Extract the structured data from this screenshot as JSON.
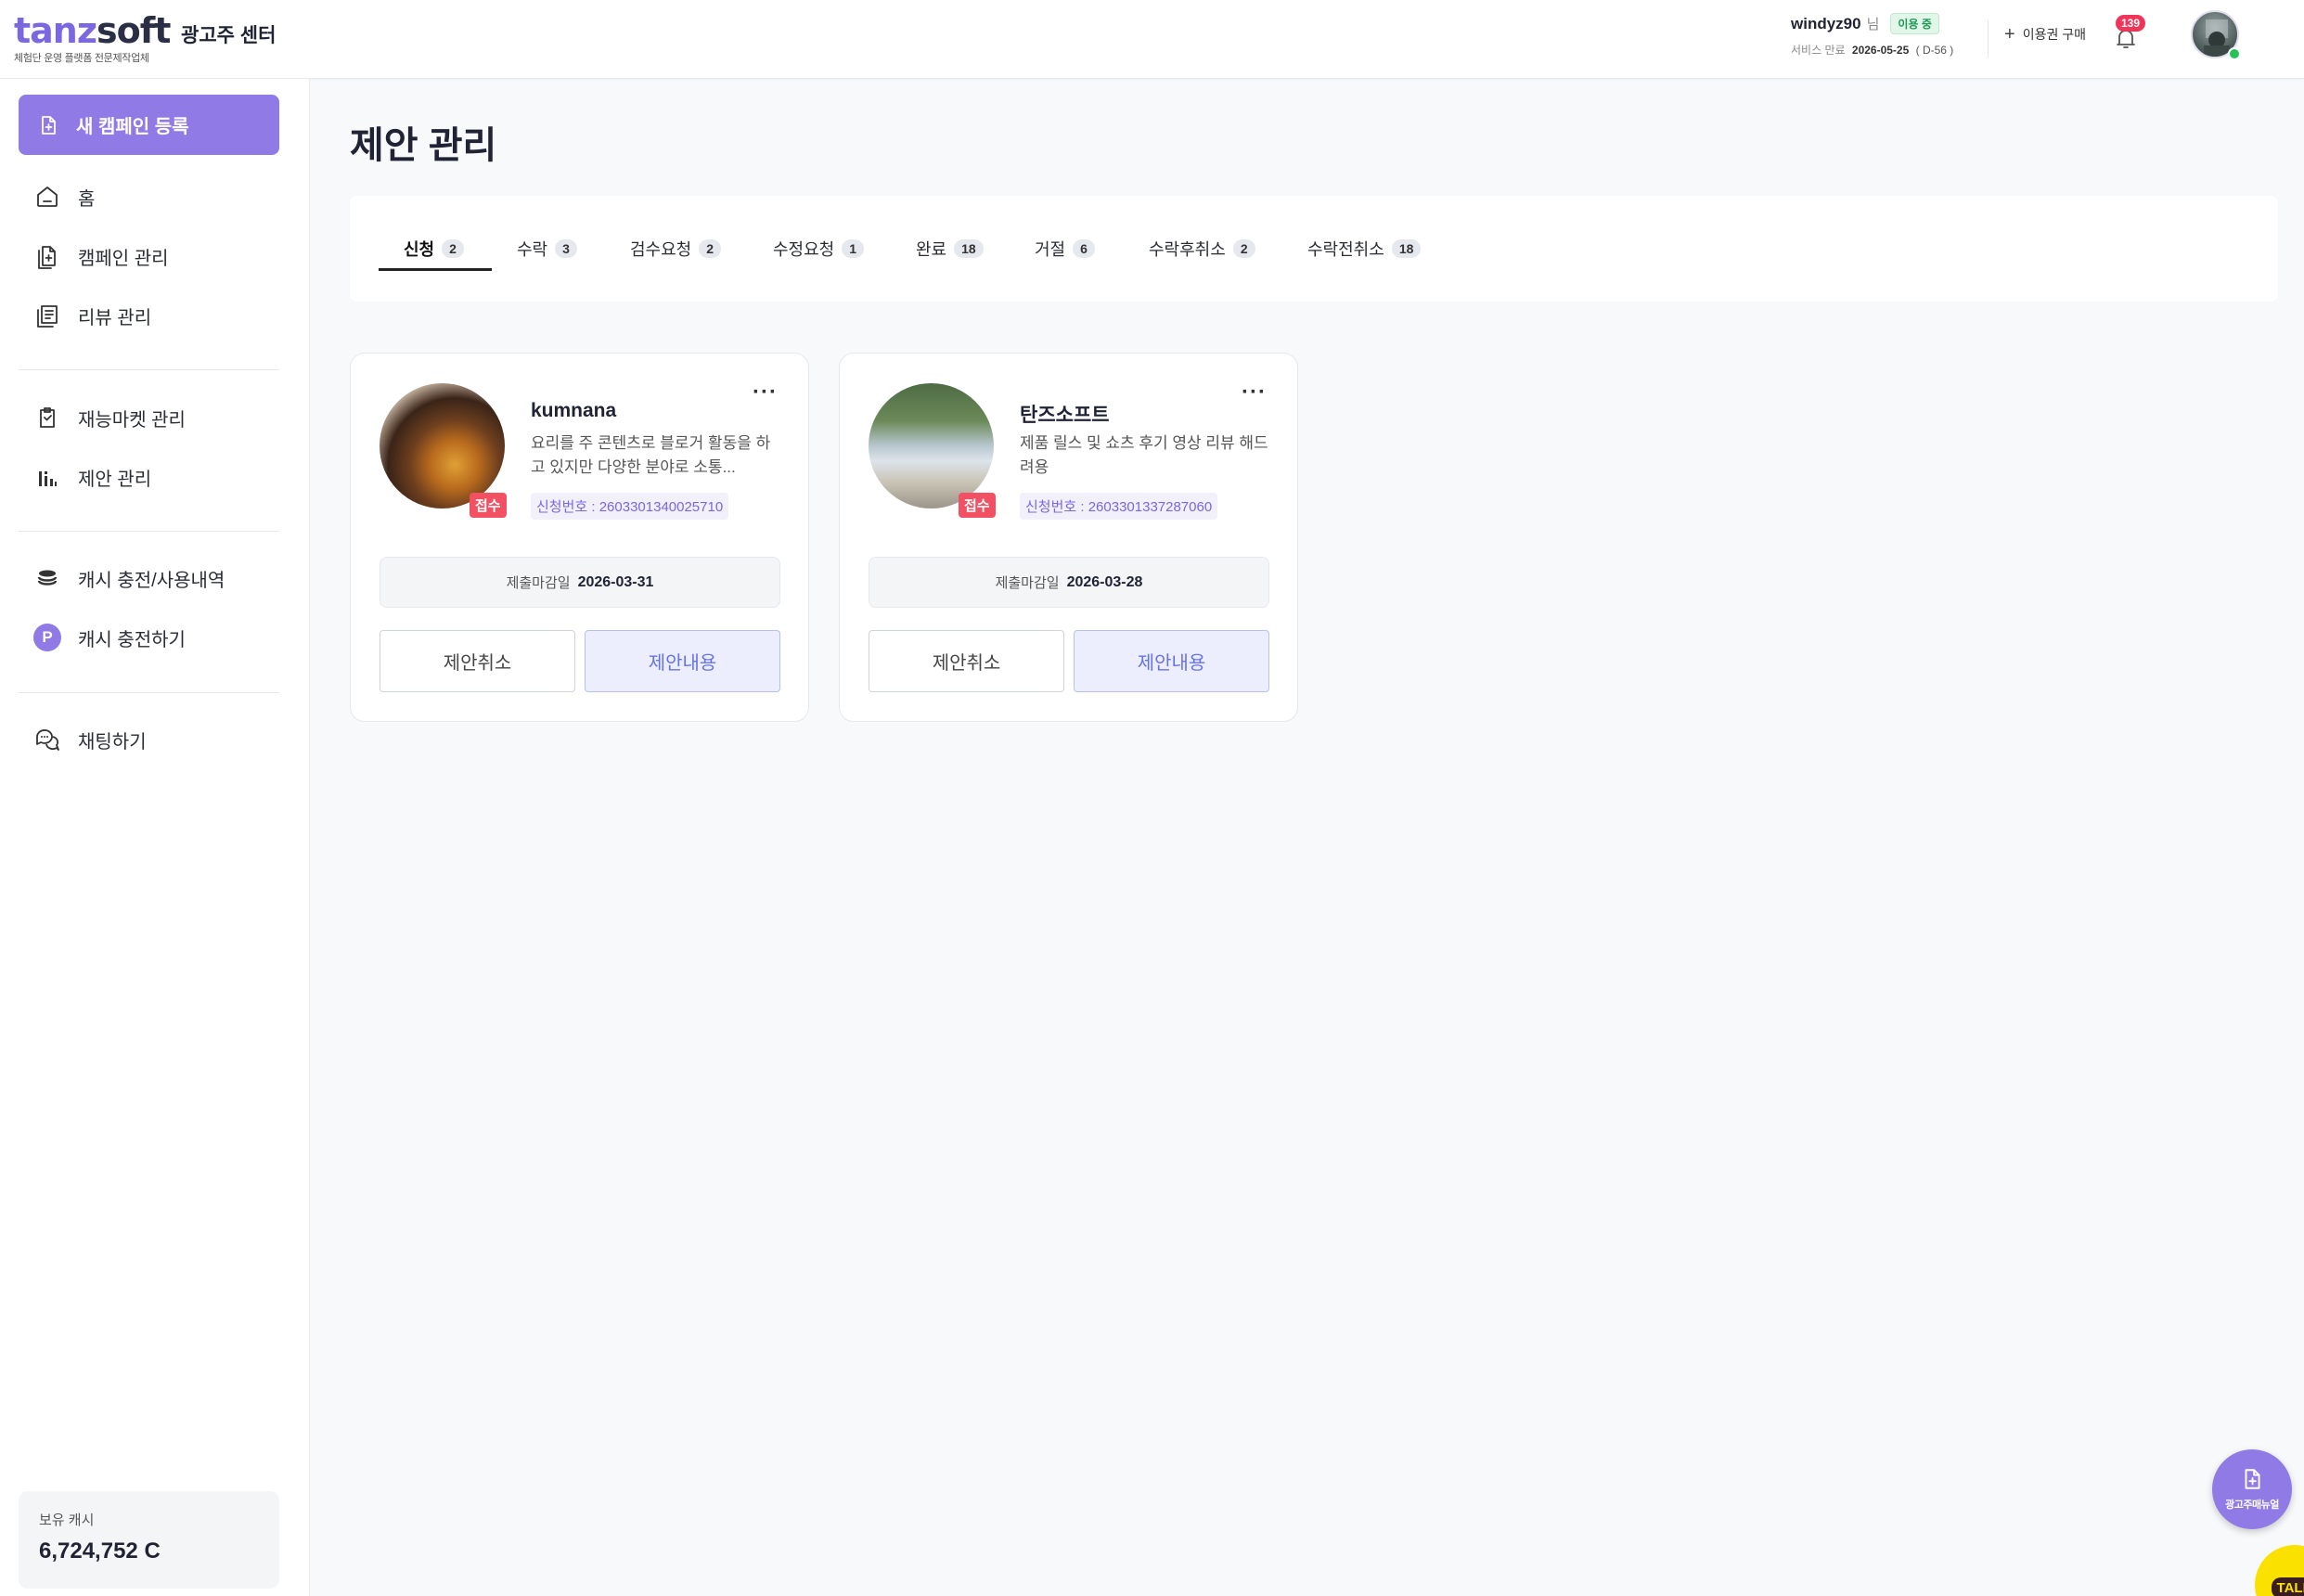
{
  "header": {
    "logo_part1": "tanz",
    "logo_part2": "soft",
    "logo_tagline": "체험단 운영 플랫폼 전문제작업체",
    "center_title": "광고주 센터",
    "user": {
      "name": "windyz90",
      "suffix": "님",
      "status": "이용 중",
      "service_end_label": "서비스 만료",
      "service_end_date": "2026-05-25",
      "dday": "( D-56 )"
    },
    "buy_label": "이용권 구매",
    "notification_count": "139",
    "avatar_icon": "user-avatar",
    "online_color": "#25c25b"
  },
  "sidebar": {
    "new_campaign_label": "새 캠페인 등록",
    "nav_group1": [
      {
        "label": "홈",
        "icon": "home-icon"
      },
      {
        "label": "캠페인 관리",
        "icon": "campaign-doc-icon"
      },
      {
        "label": "리뷰 관리",
        "icon": "review-list-icon"
      }
    ],
    "nav_group2": [
      {
        "label": "재능마켓 관리",
        "icon": "clipboard-icon"
      },
      {
        "label": "제안 관리",
        "icon": "bar-chart-icon"
      }
    ],
    "nav_group3": [
      {
        "label": "캐시 충전/사용내역",
        "icon": "coin-stack-icon"
      },
      {
        "label": "캐시 충전하기",
        "icon": "p-point-icon",
        "badge_letter": "P"
      }
    ],
    "nav_group4": [
      {
        "label": "채팅하기",
        "icon": "chat-icon"
      }
    ],
    "cash_label": "보유 캐시",
    "cash_value": "6,724,752 C"
  },
  "main": {
    "title": "제안 관리",
    "tabs": [
      {
        "label": "신청",
        "count": "2",
        "active": true
      },
      {
        "label": "수락",
        "count": "3"
      },
      {
        "label": "검수요청",
        "count": "2"
      },
      {
        "label": "수정요청",
        "count": "1"
      },
      {
        "label": "완료",
        "count": "18"
      },
      {
        "label": "거절",
        "count": "6"
      },
      {
        "label": "수락후취소",
        "count": "2"
      },
      {
        "label": "수락전취소",
        "count": "18"
      }
    ],
    "cards": [
      {
        "name": "kumnana",
        "description": "요리를 주 콘텐츠로 블로거 활동을 하고 있지만 다양한 분야로 소통...",
        "badge": "접수",
        "app_no": "신청번호 : 2603301340025710",
        "deadline_label": "제출마감일",
        "deadline": "2026-03-31",
        "cancel_label": "제안취소",
        "content_label": "제안내용"
      },
      {
        "name": "탄즈소프트",
        "description": "제품 릴스 및 쇼츠 후기 영상 리뷰 해드려용",
        "badge": "접수",
        "app_no": "신청번호 : 2603301337287060",
        "deadline_label": "제출마감일",
        "deadline": "2026-03-28",
        "cancel_label": "제안취소",
        "content_label": "제안내용"
      }
    ]
  },
  "floating": {
    "fab_label": "광고주매뉴얼",
    "talk_label": "TALK"
  },
  "colors": {
    "accent": "#8f7ae6",
    "badge_red": "#f25063",
    "kakao_yellow": "#fae100"
  }
}
